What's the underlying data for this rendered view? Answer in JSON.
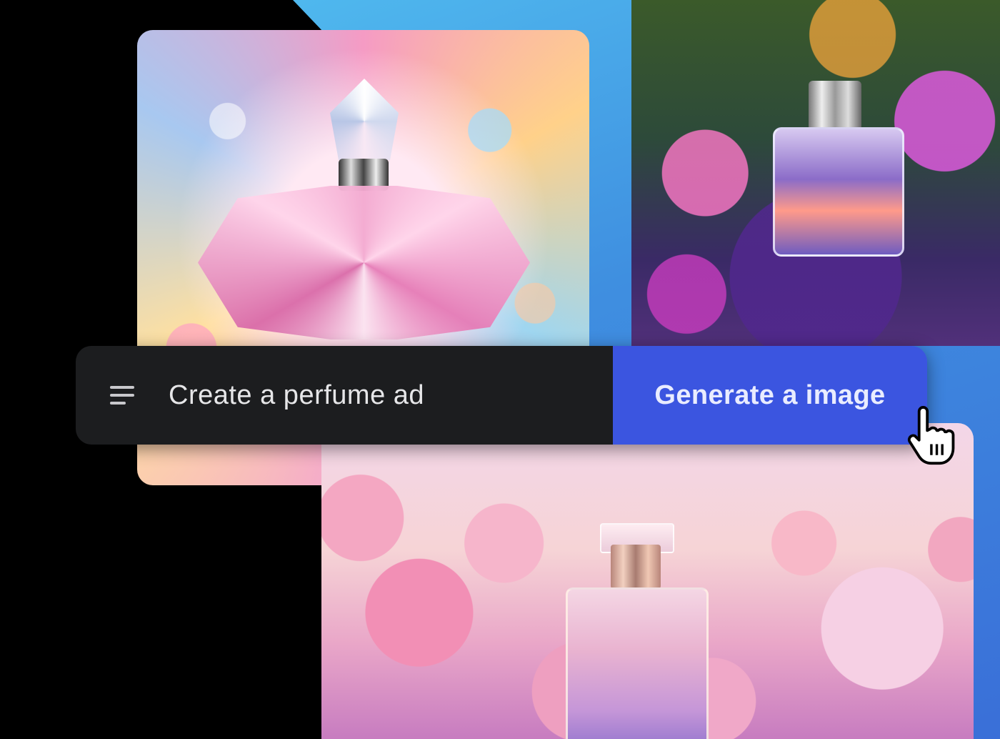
{
  "prompt": {
    "menu_icon": "menu-icon",
    "input_text": "Create a perfume ad",
    "generate_label": "Generate a image"
  },
  "images": [
    {
      "name": "crystal-perfume-bottle"
    },
    {
      "name": "tropical-perfume-bottle"
    },
    {
      "name": "rose-perfume-bottle"
    }
  ],
  "colors": {
    "background": "#000000",
    "backdrop_accent": "#3f8fe0",
    "input_bg": "#1c1d1f",
    "button_bg": "#3b55e0",
    "text_light": "#e6e6e8"
  },
  "cursor_icon": "hand-pointer-icon"
}
